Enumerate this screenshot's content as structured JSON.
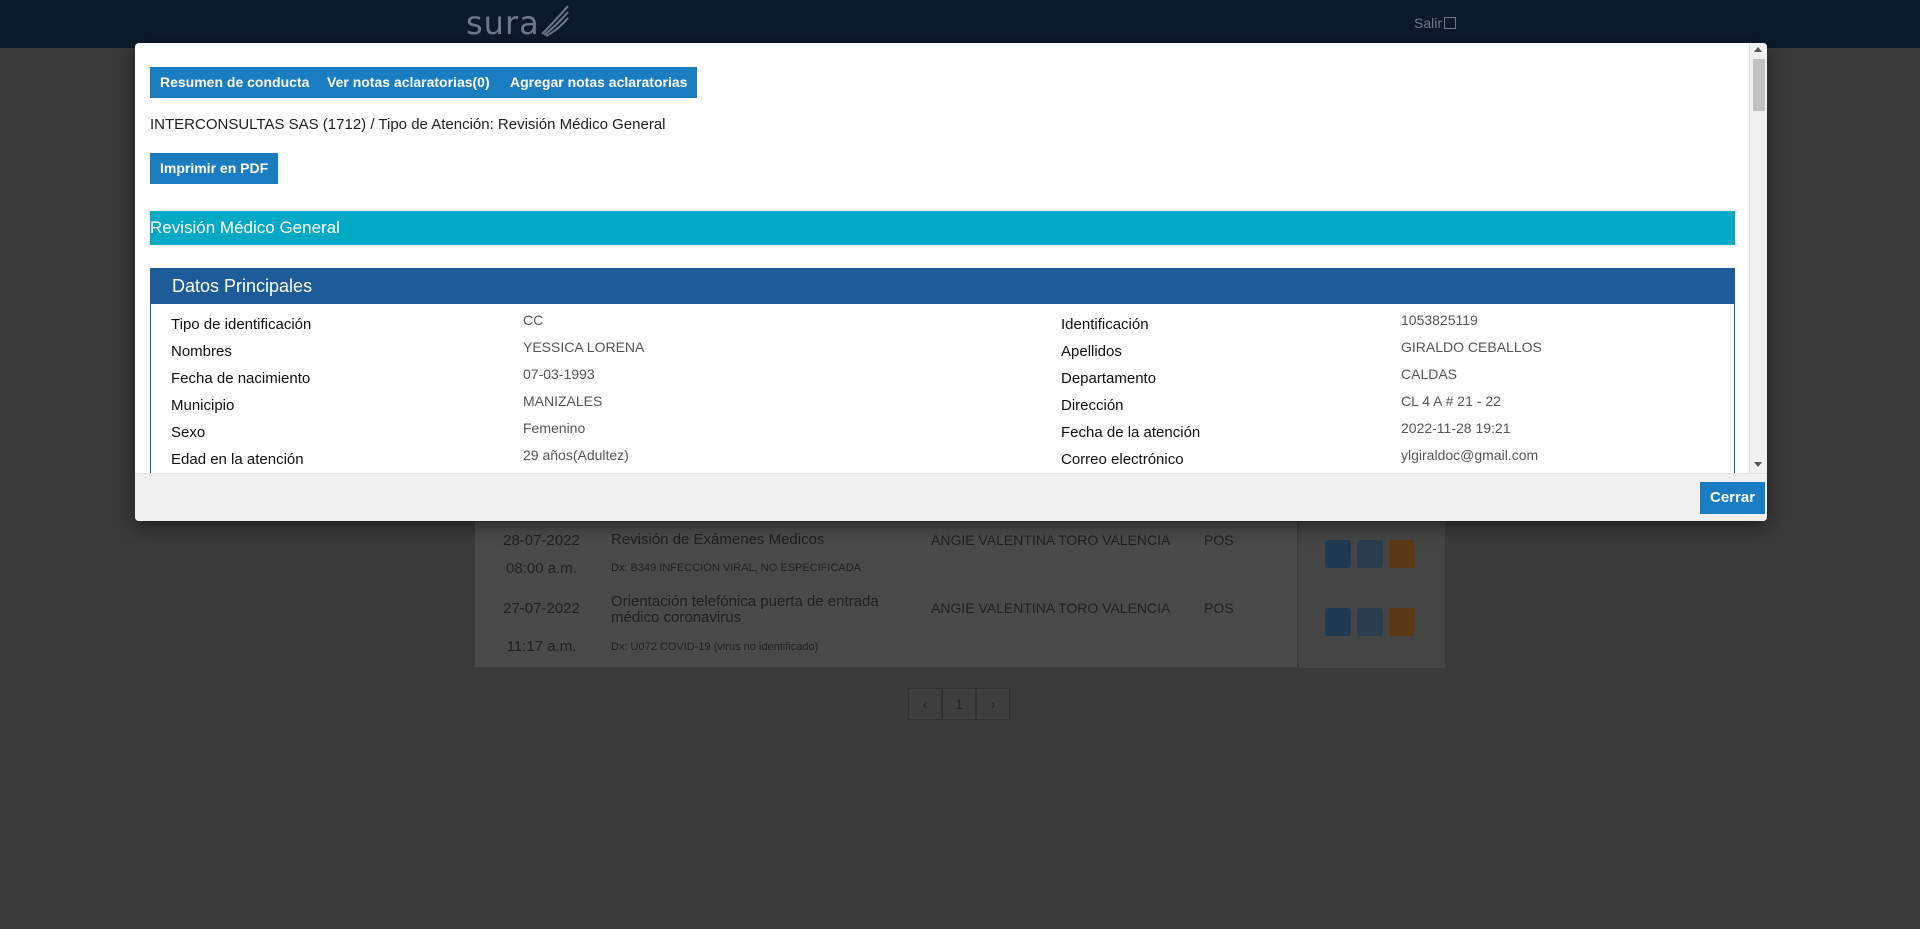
{
  "header": {
    "logo_text": "sura",
    "logout_label": "Salir"
  },
  "modal": {
    "buttons": {
      "resumen": "Resumen de conducta",
      "ver_notas": "Ver notas aclaratorias(0)",
      "agregar_notas": "Agregar notas aclaratorias",
      "imprimir_pdf": "Imprimir en PDF",
      "cerrar": "Cerrar"
    },
    "attention_line": "INTERCONSULTAS SAS (1712) / Tipo de Atención: Revisión Médico General",
    "section_title": "Revisión Médico General",
    "panel_title": "Datos Principales",
    "fields_left": [
      {
        "label": "Tipo de identificación",
        "value": "CC"
      },
      {
        "label": "Nombres",
        "value": "YESSICA LORENA"
      },
      {
        "label": "Fecha de nacimiento",
        "value": "07-03-1993"
      },
      {
        "label": "Municipio",
        "value": "MANIZALES"
      },
      {
        "label": "Sexo",
        "value": "Femenino"
      },
      {
        "label": "Edad en la atención",
        "value": "29 años(Adultez)"
      }
    ],
    "fields_right": [
      {
        "label": "Identificación",
        "value": "1053825119"
      },
      {
        "label": "Apellidos",
        "value": "GIRALDO CEBALLOS"
      },
      {
        "label": "Departamento",
        "value": "CALDAS"
      },
      {
        "label": "Dirección",
        "value": "CL 4 A # 21 - 22"
      },
      {
        "label": "Fecha de la atención",
        "value": "2022-11-28 19:21"
      },
      {
        "label": "Correo electrónico",
        "value": "ylgiraldoc@gmail.com"
      }
    ]
  },
  "background_table": {
    "rows": [
      {
        "date": "28-07-2022",
        "time": "08:00 a.m.",
        "title": "Revisión de Exámenes Medicos",
        "dx": "Dx: B349 INFECCIÓN VIRAL, NO ESPECIFICADA",
        "doctor": "ANGIE VALENTINA TORO VALENCIA",
        "plan": "POS"
      },
      {
        "date": "27-07-2022",
        "time": "11:17 a.m.",
        "title": "Orientación telefónica puerta de entrada médico coronavirus",
        "dx": "Dx: U072 COVID-19 (virus no identificado)",
        "doctor": "ANGIE VALENTINA TORO VALENCIA",
        "plan": "POS"
      }
    ],
    "pager": {
      "prev": "‹",
      "page": "1",
      "next": "›"
    }
  },
  "colors": {
    "topbar": "#0b1b2d",
    "primary_button": "#1a7cc1",
    "section_bar": "#03a9c5",
    "panel_header": "#1d5c99"
  }
}
